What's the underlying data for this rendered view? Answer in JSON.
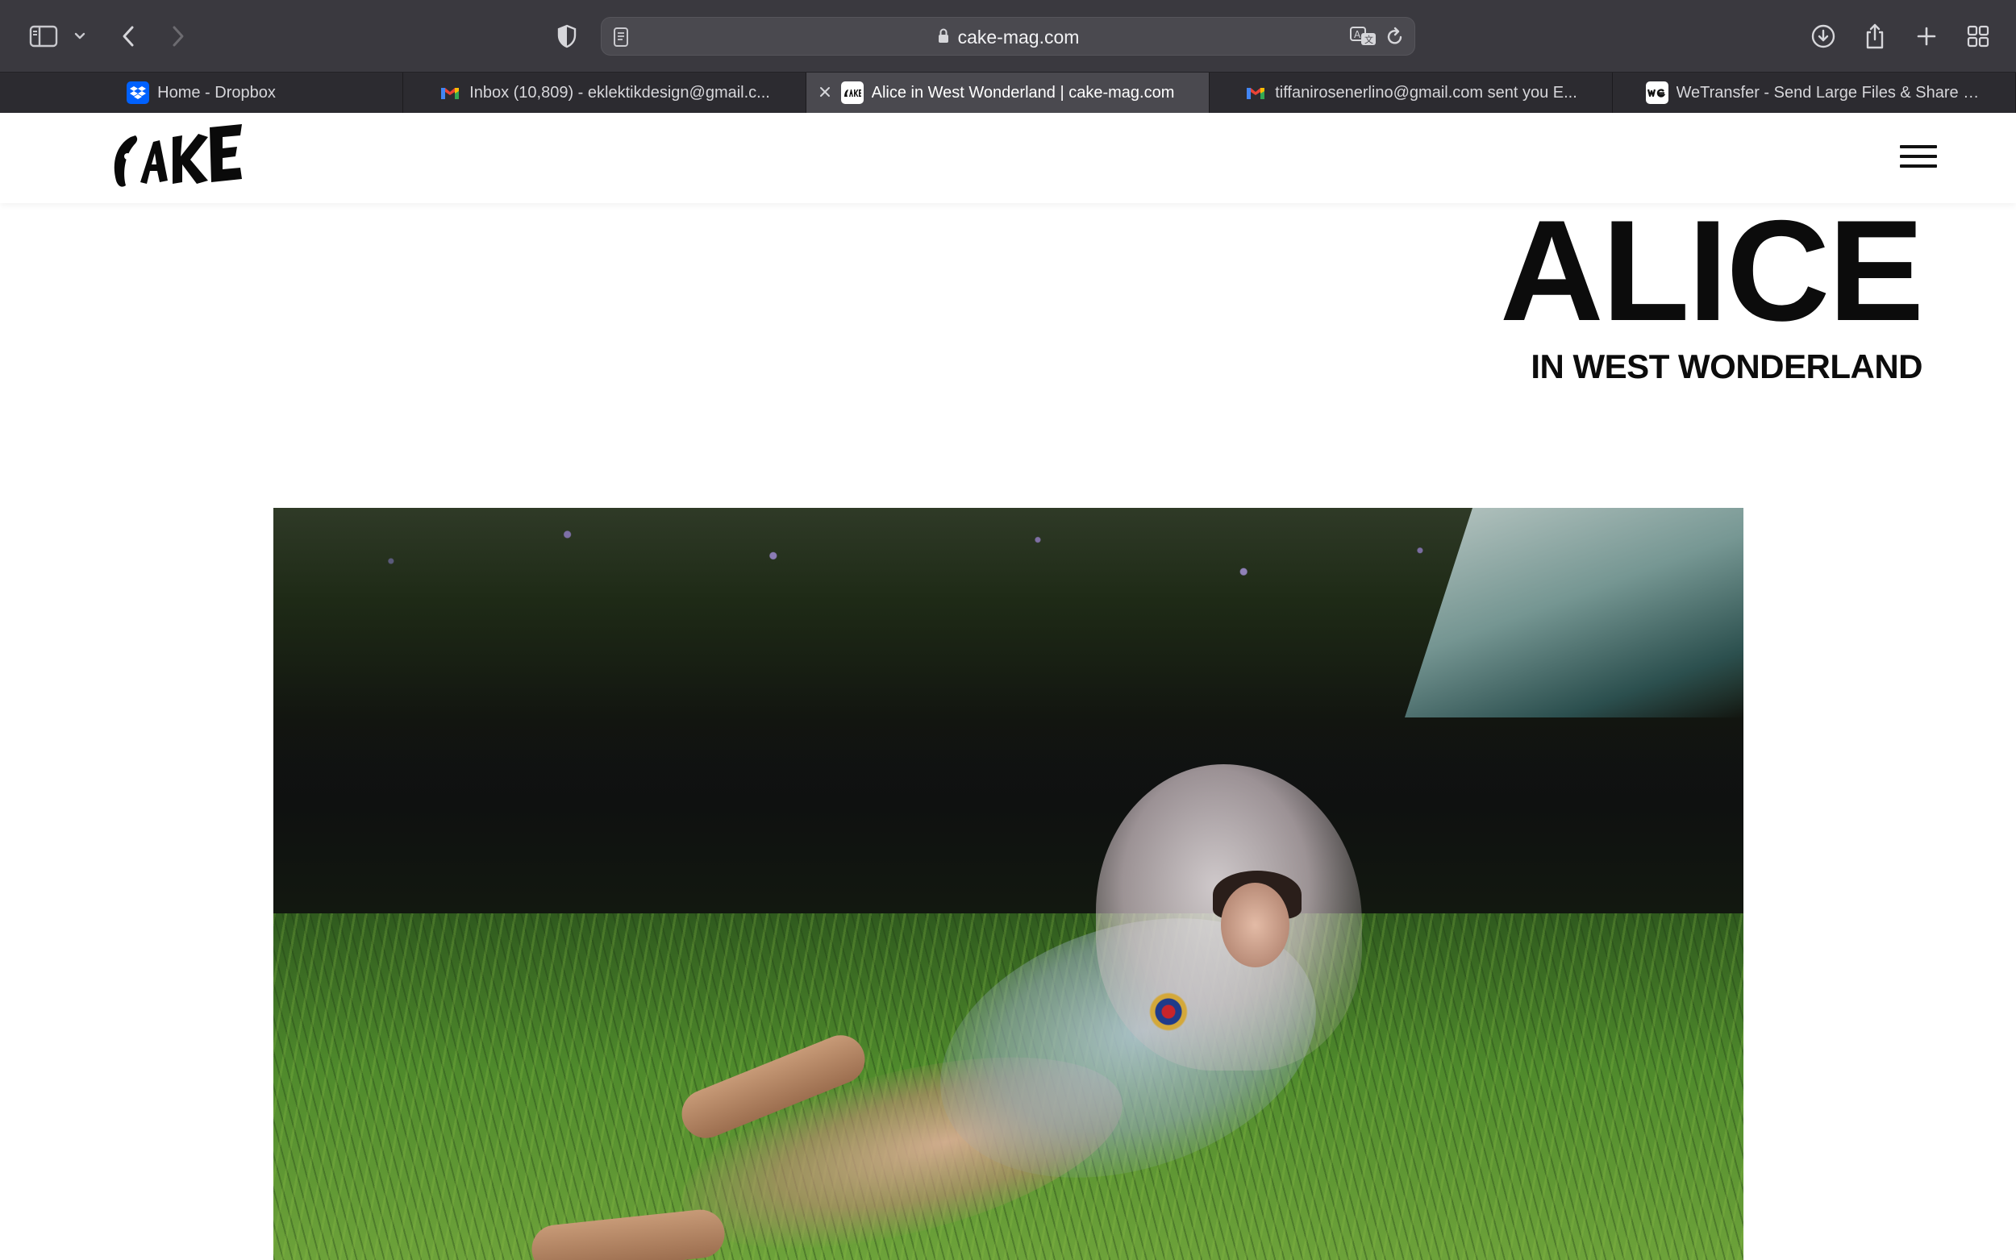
{
  "browser": {
    "url": "cake-mag.com",
    "tabs": [
      {
        "title": "Home - Dropbox",
        "favicon": "dropbox-icon",
        "active": false
      },
      {
        "title": "Inbox (10,809) - eklektikdesign@gmail.c...",
        "favicon": "gmail-icon",
        "active": false
      },
      {
        "title": "Alice in West Wonderland | cake-mag.com",
        "favicon": "cake-icon",
        "active": true
      },
      {
        "title": "tiffanirosenerlino@gmail.com sent you E...",
        "favicon": "gmail-icon",
        "active": false
      },
      {
        "title": "WeTransfer - Send Large Files & Share P...",
        "favicon": "wetransfer-icon",
        "active": false
      }
    ],
    "colors": {
      "toolbar_bg": "#3a393f",
      "tabbar_bg": "#28272b",
      "active_tab_bg": "#4a494f",
      "dropbox_blue": "#0061fe"
    }
  },
  "site": {
    "logo_text": "CAKE",
    "headline": "ALICE",
    "subheadline": "IN WEST WONDERLAND",
    "hero_image": "Model in a sheer tulle veil and pale blue dress lying on grass with cowboy boots, flowering bushes behind"
  }
}
